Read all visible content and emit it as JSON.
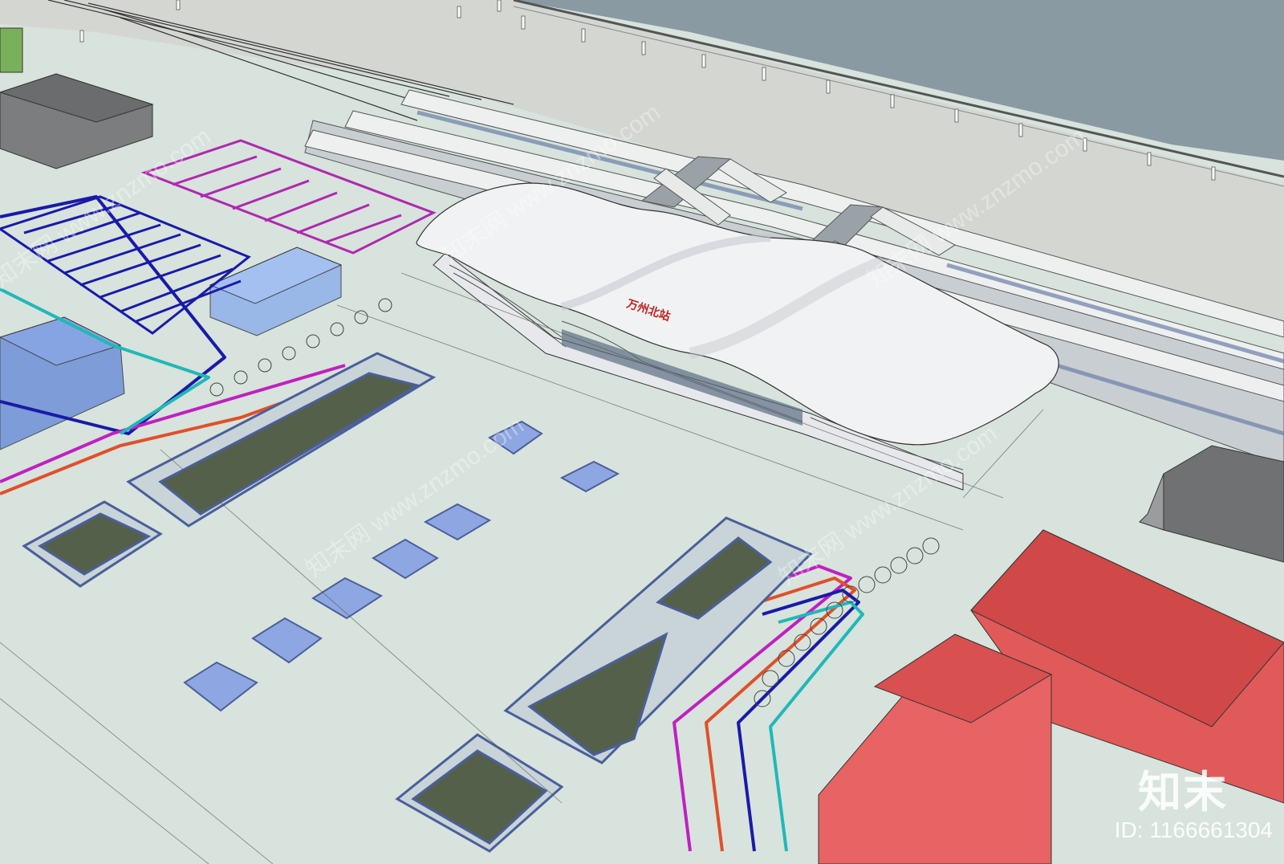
{
  "station_sign": "万州北站",
  "watermark": {
    "logo_text": "知末",
    "id_text": "ID: 1166661304",
    "diagonal_text": "知末网 www.znzmo.com"
  },
  "colors": {
    "ground": "#d7e3dc",
    "roof": "#f1f2f4",
    "red_block": "#e05a5a",
    "blue_block": "#6f90d8",
    "route_blue": "#1a1aa8",
    "route_magenta": "#c020c0",
    "route_orange": "#e0502a",
    "route_cyan": "#20b8b8",
    "sunken_green": "#55604a"
  }
}
